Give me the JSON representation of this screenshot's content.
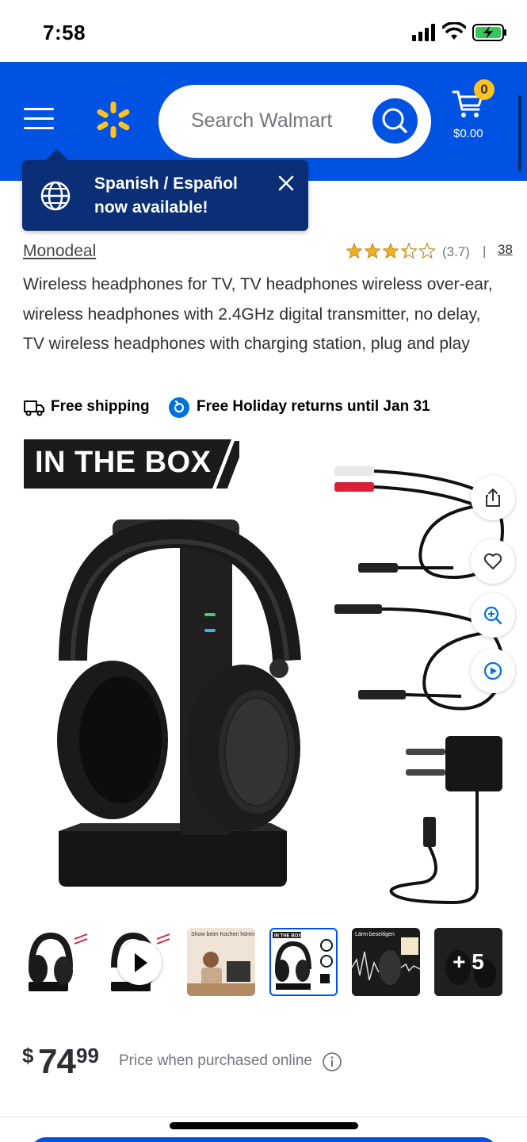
{
  "status_bar": {
    "time": "7:58"
  },
  "header": {
    "search_placeholder": "Search Walmart",
    "cart": {
      "count": "0",
      "total": "$0.00"
    },
    "accent_color": "#0053e2",
    "spark_color": "#ffc220"
  },
  "toast": {
    "line1": "Spanish / Español",
    "line2": "now available!"
  },
  "product": {
    "brand": "Monodeal",
    "rating_value": "(3.7)",
    "rating_separator": "|",
    "review_count": "38",
    "stars": 3.7,
    "title": "Wireless headphones for TV, TV headphones wireless over-ear, wireless headphones with 2.4GHz digital transmitter, no delay, TV wireless headphones with charging station, plug and play",
    "shipping": "Free shipping",
    "returns": "Free Holiday returns until Jan 31",
    "image_banner": "IN THE BOX",
    "thumbnail_more": "+ 5",
    "thumbnail_text_3": "Show beim Kochen hören",
    "thumbnail_text_4": "IN THE BOX",
    "thumbnail_text_5": "Lärm beseitigen",
    "price": {
      "currency": "$",
      "dollars": "74",
      "cents": "99"
    },
    "price_note": "Price when purchased online"
  }
}
